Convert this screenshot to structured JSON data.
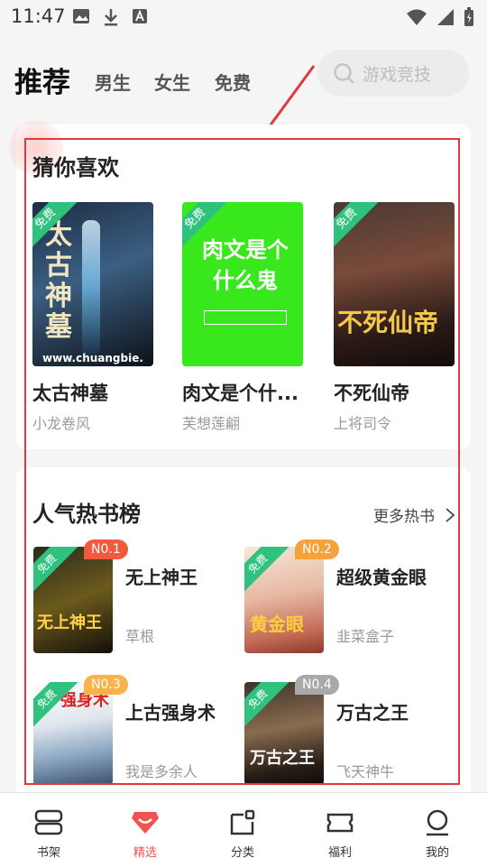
{
  "status_bar": {
    "time": "11:47"
  },
  "top_nav": {
    "tabs": [
      {
        "label": "推荐",
        "active": true
      },
      {
        "label": "男生"
      },
      {
        "label": "女生"
      },
      {
        "label": "免费"
      }
    ],
    "search_placeholder": "游戏竞技"
  },
  "guess_you_like": {
    "title": "猜你喜欢",
    "books": [
      {
        "title": "太古神墓",
        "author": "小龙卷风",
        "badge": "免费",
        "cover_text": "太古神墓",
        "cover_url_text": "www.chuangbie."
      },
      {
        "title": "肉文是个什...",
        "author": "芙想莲翩",
        "badge": "免费",
        "cover_text": "肉文是个什么鬼"
      },
      {
        "title": "不死仙帝",
        "author": "上将司令",
        "badge": "免费",
        "cover_text": "不死仙帝"
      }
    ]
  },
  "hot_rank": {
    "title": "人气热书榜",
    "more_label": "更多热书",
    "books": [
      {
        "rank": "N0.1",
        "title": "无上神王",
        "author": "草根",
        "badge": "免费",
        "cover_text": "无上神王"
      },
      {
        "rank": "N0.2",
        "title": "超级黄金眼",
        "author": "韭菜盒子",
        "badge": "免费",
        "cover_text": "黄金眼"
      },
      {
        "rank": "N0.3",
        "title": "上古强身术",
        "author": "我是多余人",
        "badge": "免费",
        "cover_text": "强身术"
      },
      {
        "rank": "N0.4",
        "title": "万古之王",
        "author": "飞天神牛",
        "badge": "免费",
        "cover_text": "万古之王"
      }
    ]
  },
  "bottom_nav": {
    "items": [
      {
        "label": "书架"
      },
      {
        "label": "精选",
        "active": true
      },
      {
        "label": "分类"
      },
      {
        "label": "福利"
      },
      {
        "label": "我的"
      }
    ]
  },
  "colors": {
    "accent": "#f0524f",
    "badge_green": "#2ec27e",
    "annotation_red": "#e0393e"
  }
}
